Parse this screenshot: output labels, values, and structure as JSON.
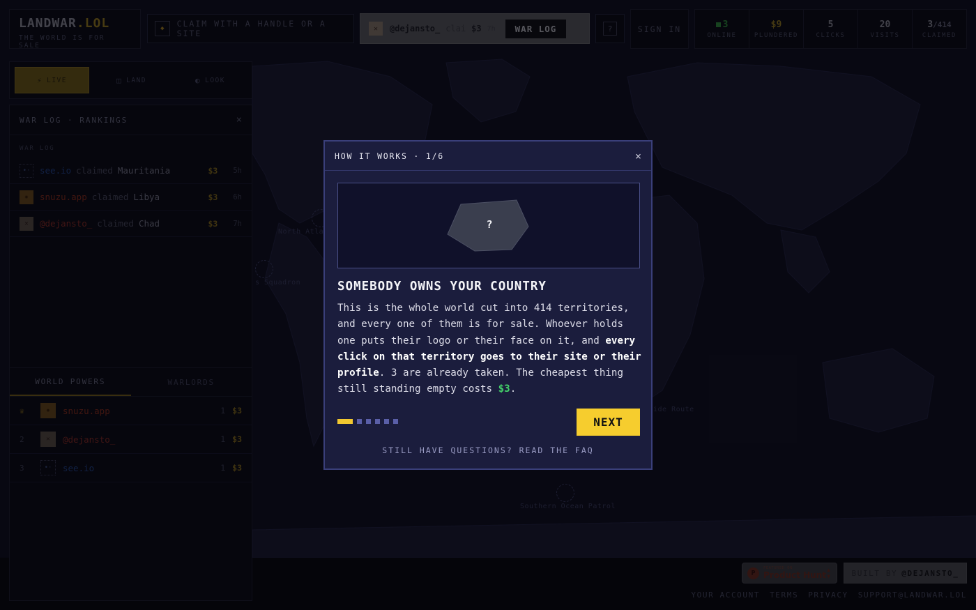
{
  "brand": {
    "name_main": "LANDWAR",
    "name_dot": ".LOL",
    "tagline": "THE WORLD IS FOR SALE"
  },
  "claim": {
    "icon": "diamond-icon",
    "label": "CLAIM WITH A HANDLE OR A SITE"
  },
  "ticker": {
    "handle": "@dejansto_",
    "verb": "clai",
    "price": "$3",
    "age": "7h",
    "button": "WAR LOG"
  },
  "help": {
    "label": "?"
  },
  "signin": {
    "label": "SIGN IN"
  },
  "stats": {
    "online": {
      "value": "3",
      "label": "ONLINE"
    },
    "plundered": {
      "value": "$9",
      "label": "PLUNDERED"
    },
    "clicks": {
      "value": "5",
      "label": "CLICKS"
    },
    "visits": {
      "value": "20",
      "label": "VISITS"
    },
    "claimed": {
      "value": "3",
      "total": "/414",
      "label": "CLAIMED"
    }
  },
  "modes": [
    {
      "icon": "lightning-icon",
      "label": "LIVE",
      "active": true
    },
    {
      "icon": "grid-icon",
      "label": "LAND",
      "active": false
    },
    {
      "icon": "contrast-icon",
      "label": "LOOK",
      "active": false
    }
  ],
  "panel": {
    "title": "WAR LOG · RANKINGS",
    "close": "×",
    "log_label": "WAR LOG",
    "log": [
      {
        "who": "see.io",
        "verb": "claimed",
        "territory": "Mauritania",
        "price": "$3",
        "age": "5h",
        "color": "#22448c"
      },
      {
        "who": "snuzu.app",
        "verb": "claimed",
        "territory": "Libya",
        "price": "$3",
        "age": "6h",
        "color": "#8c2d1a"
      },
      {
        "who": "@dejansto_",
        "verb": "claimed",
        "territory": "Chad",
        "price": "$3",
        "age": "7h",
        "color": "#8a2a22"
      }
    ],
    "tabs": [
      {
        "label": "WORLD POWERS",
        "active": true
      },
      {
        "label": "WARLORDS",
        "active": false
      }
    ],
    "rankings": [
      {
        "pos": "♛",
        "who": "snuzu.app",
        "count": "1",
        "price": "$3"
      },
      {
        "pos": "2",
        "who": "@dejansto_",
        "count": "1",
        "price": "$3"
      },
      {
        "pos": "3",
        "who": "see.io",
        "count": "1",
        "price": "$3"
      }
    ]
  },
  "map_labels": {
    "north_atlantic": "North Atla",
    "squadron": "s Squadron",
    "silk_route": "ide Route",
    "southern_ocean": "Southern Ocean Patrol"
  },
  "footer": {
    "ph_featured": "FEATURED ON",
    "ph_name": "Product Hunt",
    "built_prefix": "BUILT BY",
    "built_name": "@DEJANSTO_",
    "links": [
      "YOUR ACCOUNT",
      "TERMS",
      "PRIVACY",
      "SUPPORT@LANDWAR.LOL"
    ]
  },
  "modal": {
    "header": "HOW IT WORKS · 1/6",
    "close": "×",
    "illustration_mark": "?",
    "title": "SOMEBODY OWNS YOUR COUNTRY",
    "body_1": "This is the whole world cut into 414 territories, and every one of them is for sale. Whoever holds one puts their logo or their face on it, and ",
    "body_bold": "every click on that territory goes to their site or their profile",
    "body_2": ". 3 are already taken. The cheapest thing still standing empty costs ",
    "body_price": "$3",
    "body_end": ".",
    "step_current": 1,
    "step_total": 6,
    "next": "NEXT",
    "faq": "STILL HAVE QUESTIONS? READ THE FAQ"
  },
  "colors": {
    "accent": "#f6cd2e",
    "modal_bg": "#1b1d3d",
    "money_green": "#44d16a"
  }
}
